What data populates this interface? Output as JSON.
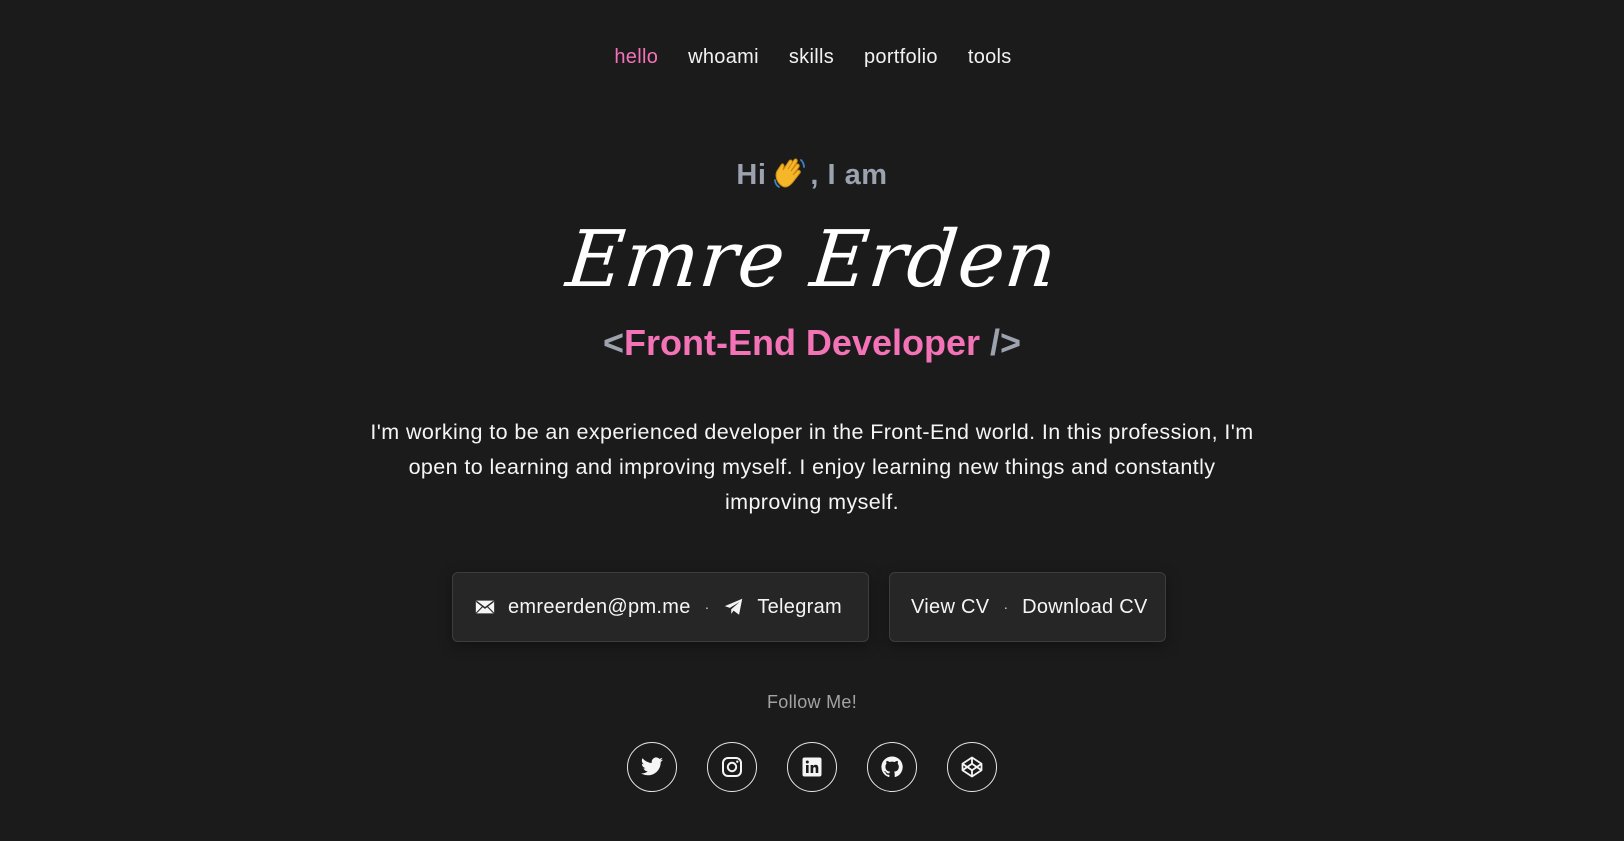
{
  "nav": {
    "items": [
      {
        "label": "hello",
        "active": true
      },
      {
        "label": "whoami",
        "active": false
      },
      {
        "label": "skills",
        "active": false
      },
      {
        "label": "portfolio",
        "active": false
      },
      {
        "label": "tools",
        "active": false
      }
    ]
  },
  "hero": {
    "greeting_prefix": "Hi",
    "greeting_emoji": "waving-hand-icon",
    "greeting_suffix": ", I am",
    "name": "Emre Erden",
    "role_open": "<",
    "role_title": "Front-End Developer",
    "role_close": " />",
    "bio": "I'm working to be an experienced developer in the Front-End world. In this profession, I'm open to learning and improving myself. I enjoy learning new things and constantly improving myself."
  },
  "contact": {
    "email": "emreerden@pm.me",
    "email_icon": "envelope-icon",
    "separator": "·",
    "telegram": "Telegram",
    "telegram_icon": "paper-plane-icon"
  },
  "cv": {
    "view": "View CV",
    "separator": "·",
    "download": "Download CV"
  },
  "follow": {
    "label": "Follow Me!",
    "socials": [
      "twitter-icon",
      "instagram-icon",
      "linkedin-icon",
      "github-icon",
      "codepen-icon"
    ]
  },
  "colors": {
    "background": "#1b1b1c",
    "accent": "#f472b6",
    "muted": "#9ca3af",
    "card": "#262627"
  }
}
